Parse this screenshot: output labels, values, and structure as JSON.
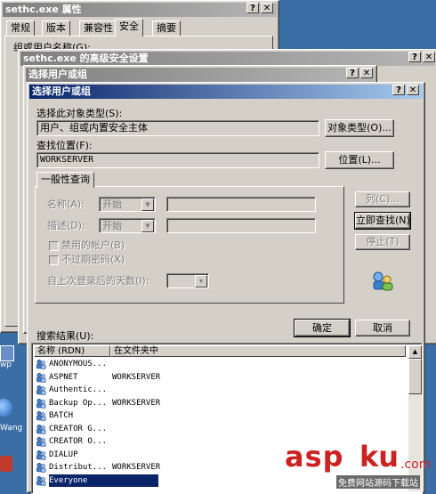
{
  "desktop": {
    "label1": "wp",
    "label2": "Wang"
  },
  "props_window": {
    "title": "sethc.exe 属性",
    "tabs": [
      "常规",
      "版本",
      "兼容性",
      "安全",
      "摘要"
    ],
    "active_tab": 3,
    "group_label": "组或用户名称(G):"
  },
  "adv_window": {
    "title": "sethc.exe 的高级安全设置"
  },
  "outer_select": {
    "title": "选择用户或组"
  },
  "dialog": {
    "title": "选择用户或组",
    "object_type_label": "选择此对象类型(S):",
    "object_type_value": "用户、组或内置安全主体",
    "object_type_button": "对象类型(O)...",
    "location_label": "查找位置(F):",
    "location_value": "WORKSERVER",
    "location_button": "位置(L)...",
    "tab_general": "一般性查询",
    "name_label": "名称(A):",
    "name_op": "开始",
    "desc_label": "描述(D):",
    "desc_op": "开始",
    "disabled_accounts": "禁用的帐户(B)",
    "no_expire_password": "不过期密码(X)",
    "days_since_logon": "自上次登录后的天数(I):",
    "columns_button": "列(C)...",
    "find_now_button": "立即查找(N)",
    "stop_button": "停止(T)",
    "ok_button": "确定",
    "cancel_button": "取消",
    "results_label": "搜索结果(U):",
    "col_name": "名称 (RDN)",
    "col_folder": "在文件夹中",
    "results": [
      {
        "name": "ANONYMOUS...",
        "folder": ""
      },
      {
        "name": "ASPNET",
        "folder": "WORKSERVER"
      },
      {
        "name": "Authentic...",
        "folder": ""
      },
      {
        "name": "Backup Op...",
        "folder": "WORKSERVER"
      },
      {
        "name": "BATCH",
        "folder": ""
      },
      {
        "name": "CREATOR G...",
        "folder": ""
      },
      {
        "name": "CREATOR O...",
        "folder": ""
      },
      {
        "name": "DIALUP",
        "folder": ""
      },
      {
        "name": "Distribut...",
        "folder": "WORKSERVER"
      },
      {
        "name": "Everyone",
        "folder": ""
      }
    ],
    "selected_index": 9
  },
  "watermark": {
    "brand": "asp",
    "brand2": "ku",
    "tld": ".com",
    "tagline": "免费网站源码下载站"
  },
  "colors": {
    "title_active": "#0a246a",
    "title_inactive": "#808080",
    "face": "#d4d0c8",
    "watermark": "#cc2222"
  }
}
